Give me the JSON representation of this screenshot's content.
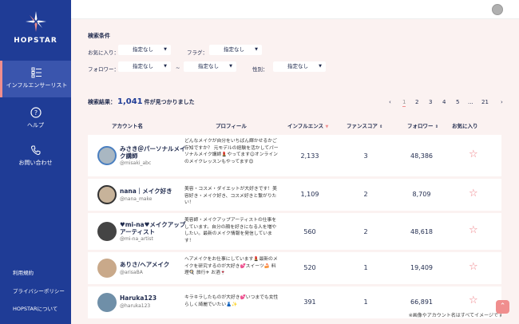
{
  "brand": {
    "name": "HOPSTAR"
  },
  "nav": [
    {
      "label": "インフルエンサーリスト"
    },
    {
      "label": "ヘルプ"
    },
    {
      "label": "お問い合わせ"
    }
  ],
  "footer_links": [
    "利用規約",
    "プライバシーポリシー",
    "HOPSTARについて"
  ],
  "filters": {
    "title": "検索条件",
    "favorite_label": "お気に入り：",
    "flag_label": "フラグ：",
    "follower_label": "フォロワー：",
    "gender_label": "性別：",
    "range_separator": "~",
    "default_value": "指定なし"
  },
  "results": {
    "prefix": "検索結果：",
    "count": "1,041",
    "suffix": "件が見つかりました"
  },
  "pagination": {
    "prev": "‹",
    "pages": [
      "1",
      "2",
      "3",
      "4",
      "5",
      "...",
      "21"
    ],
    "next": "›"
  },
  "table": {
    "headers": [
      "アカウント名",
      "プロフィール",
      "インフルエンス",
      "ファンスコア",
      "フォロワー",
      "お気に入り"
    ],
    "rows": [
      {
        "name": "みさき＠パーソナルメイク講師",
        "handle": "@misaki_abc",
        "profile": "どんなメイクが自分をいちばん輝かせるかご存知ですか？ 元モデルの経験を活かしてパーソナルメイク講師💄やってます☺オンラインのメイクレッスンもやってます😊",
        "influence": "2,133",
        "fan": "3",
        "followers": "48,386",
        "avatar_color": "#a9b7c2"
      },
      {
        "name": "nana｜メイク好き",
        "handle": "@nana_make",
        "profile": "美容・コスメ・ダイエットが大好きです！美容好き・メイク好き、コスメ好きと繋がりたい！",
        "influence": "1,109",
        "fan": "2",
        "followers": "8,709",
        "avatar_color": "#c7b39a"
      },
      {
        "name": "♥mi-na♥メイクアップアーティスト",
        "handle": "@mi-na_artist",
        "profile": "美容師・メイクアップアーティストの仕事をしています。自分の顔を好きになる人を増やしたい。最新のメイク情報を発信しています！",
        "influence": "560",
        "fan": "2",
        "followers": "48,618",
        "avatar_color": "#444444"
      },
      {
        "name": "ありさ/ヘアメイク",
        "handle": "@arisaBA",
        "profile": "ヘアメイクをお仕事にしています💄最新のメイクを研究するのが大好き💕スイーツ🍰 料理🍳 旅行✈ お酒🍷",
        "influence": "520",
        "fan": "1",
        "followers": "19,409",
        "avatar_color": "#c9a98a"
      },
      {
        "name": "Haruka123",
        "handle": "@haruka123",
        "profile": "キラキラしたものが大好き💕いつまでも女性らしく綺麗でいたい👗✨",
        "influence": "391",
        "fan": "1",
        "followers": "66,891",
        "avatar_color": "#6f8fa8"
      }
    ]
  },
  "note": "※画像やアカウント名はすべてイメージです",
  "colors": {
    "sidebar": "#1f3c96",
    "accent": "#f08e8e",
    "background": "#fbf2f1"
  }
}
